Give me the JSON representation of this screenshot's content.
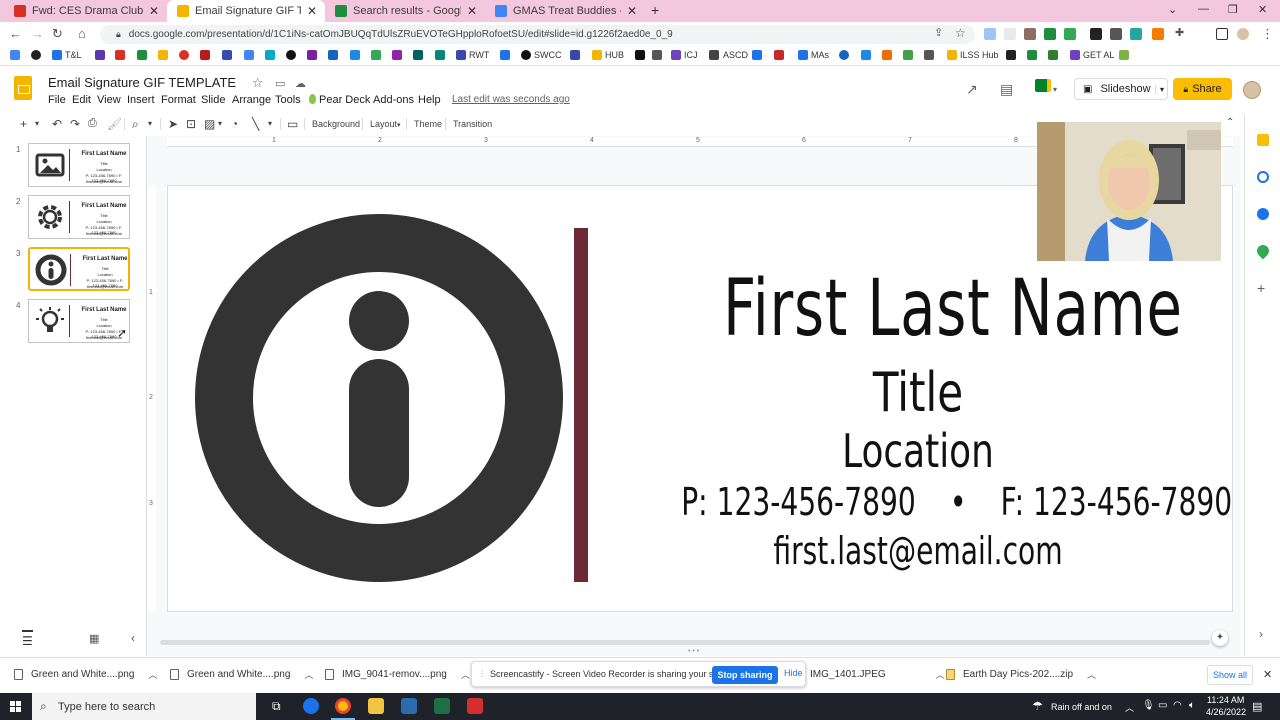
{
  "browser": {
    "tabs": [
      {
        "title": "Fwd: CES Drama Club - Aladdin",
        "icon_color": "#d93025"
      },
      {
        "title": "Email Signature GIF TEMPLATE -",
        "icon_color": "#f4b400"
      },
      {
        "title": "Search results - Google Drive",
        "icon_color": "#1e8e3e"
      },
      {
        "title": "GMAS Treat Buddies - Google Do",
        "icon_color": "#4285f4"
      }
    ],
    "new_tab": "+",
    "url": "docs.google.com/presentation/d/1C1iNs-catOmJBUQqTdUlsZRuEVOTeGHpploRofoetSU/edit#slide=id.g1226f2aed0e_0_9",
    "bookmarks": [
      "T&L",
      "RWT",
      "SWCC",
      "HUB",
      "ICJ",
      "ASCD",
      "MAs",
      "ILSS Hub",
      "GET AL"
    ],
    "bookmark_colors": [
      "#4285f4",
      "#d93025",
      "#1e8e3e",
      "#f4b400",
      "#6f42c1",
      "#00897b",
      "#e37400",
      "#c2185b"
    ]
  },
  "slides_header": {
    "doc_title": "Email Signature GIF TEMPLATE",
    "menus": [
      "File",
      "Edit",
      "View",
      "Insert",
      "Format",
      "Slide",
      "Arrange",
      "Tools",
      "Pear Deck",
      "Add-ons",
      "Help"
    ],
    "last_edit": "Last edit was seconds ago",
    "slideshow_label": "Slideshow",
    "share_label": "Share"
  },
  "toolbar": {
    "background": "Background",
    "layout": "Layout",
    "theme": "Theme",
    "transition": "Transition"
  },
  "ruler": {
    "ticks": [
      "1",
      "2",
      "3",
      "4",
      "5",
      "6",
      "7",
      "8"
    ]
  },
  "filmstrip": {
    "slides": [
      {
        "number": "1",
        "icon": "image-icon"
      },
      {
        "number": "2",
        "icon": "gear-icon"
      },
      {
        "number": "3",
        "icon": "info-icon"
      },
      {
        "number": "4",
        "icon": "lightbulb-icon"
      }
    ],
    "thumb_name": "First Last Name",
    "thumb_title": "Title",
    "thumb_location": "Location",
    "thumb_phone": "P: 123-456-7890  •  F: 123-456-7890",
    "thumb_email": "first.last@email.com",
    "selected_index": 3
  },
  "slide": {
    "name": "First Last Name",
    "title": "Title",
    "location": "Location",
    "phone": "P: 123-456-7890",
    "separator": "•",
    "fax": "F: 123-456-7890",
    "email": "first.last@email.com",
    "accent_color": "#6b2a36",
    "icon_color": "#333333"
  },
  "downloads": {
    "items": [
      "Green and White....png",
      "Green and White....png",
      "IMG_9041-remov....png",
      "IMG_1401.JPEG",
      "Earth Day Pics-202....zip"
    ],
    "share_message": "Screencastify - Screen Video Recorder is sharing your screen.",
    "stop_sharing": "Stop sharing",
    "hide": "Hide",
    "show_all": "Show all"
  },
  "taskbar": {
    "search_placeholder": "Type here to search",
    "weather": "Rain off and on",
    "time": "11:24 AM",
    "date": "4/26/2022"
  }
}
